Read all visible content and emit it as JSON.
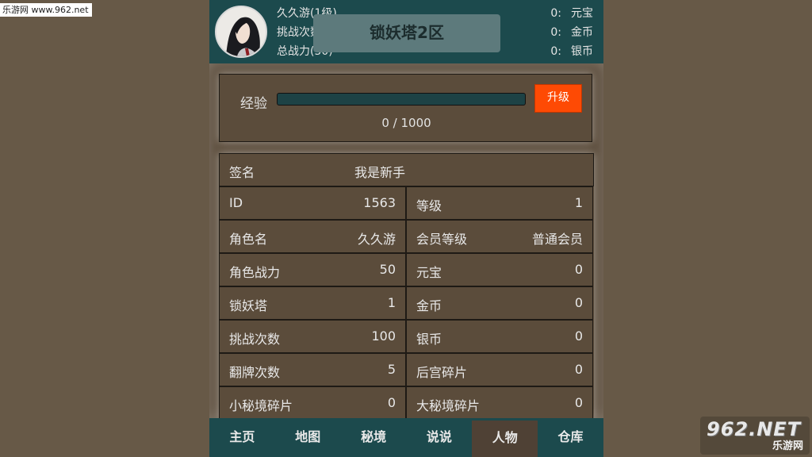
{
  "watermark_top": "乐游网 www.962.net",
  "watermark_bottom": {
    "big": "962.NET",
    "small": "乐游网"
  },
  "header": {
    "stats": [
      "久久游(1级)",
      "挑战次数(100)",
      "总战力(50)"
    ],
    "server": "锁妖塔2区",
    "currency": [
      {
        "value": "0:",
        "label": "元宝"
      },
      {
        "value": "0:",
        "label": "金币"
      },
      {
        "value": "0:",
        "label": "银币"
      }
    ]
  },
  "exp": {
    "label": "经验",
    "value": "0 / 1000",
    "progress": 0,
    "upgrade_label": "升级"
  },
  "info": {
    "signature": {
      "label": "签名",
      "value": "我是新手"
    },
    "rows": [
      [
        {
          "k": "ID",
          "v": "1563"
        },
        {
          "k": "等级",
          "v": "1"
        }
      ],
      [
        {
          "k": "角色名",
          "v": "久久游"
        },
        {
          "k": "会员等级",
          "v": "普通会员"
        }
      ],
      [
        {
          "k": "角色战力",
          "v": "50"
        },
        {
          "k": "元宝",
          "v": "0"
        }
      ],
      [
        {
          "k": "锁妖塔",
          "v": "1"
        },
        {
          "k": "金币",
          "v": "0"
        }
      ],
      [
        {
          "k": "挑战次数",
          "v": "100"
        },
        {
          "k": "银币",
          "v": "0"
        }
      ],
      [
        {
          "k": "翻牌次数",
          "v": "5"
        },
        {
          "k": "后宫碎片",
          "v": "0"
        }
      ],
      [
        {
          "k": "小秘境碎片",
          "v": "0"
        },
        {
          "k": "大秘境碎片",
          "v": "0"
        }
      ]
    ]
  },
  "nav": {
    "tabs": [
      "主页",
      "地图",
      "秘境",
      "说说",
      "人物",
      "仓库"
    ],
    "active": "人物"
  },
  "colors": {
    "header_bg": "#1c4a4d",
    "panel_bg": "#5b4c3b",
    "upgrade_bg": "#fe4a04"
  }
}
